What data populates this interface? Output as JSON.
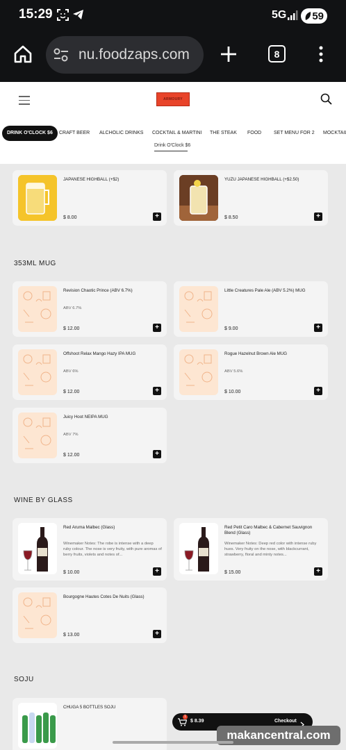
{
  "status": {
    "time": "15:29",
    "network": "5G",
    "battery": "59"
  },
  "browser": {
    "url": "nu.foodzaps.com",
    "tab_count": "8"
  },
  "site": {
    "logo_text": "ARMOURY"
  },
  "categories": [
    "DRINK O'CLOCK $6",
    "CRAFT BEER",
    "ALCHOLIC DRINKS",
    "COCKTAIL & MARTINI",
    "THE STEAK",
    "FOOD",
    "SET MENU FOR 2",
    "MOCKTAIL"
  ],
  "subcategory": "Drink O'Clock $6",
  "top_items": [
    {
      "name": "JAPANESE HIGHBALL (+$2)",
      "price": "$ 8.00"
    },
    {
      "name": "YUZU JAPANESE HIGHBALL (+$2.50)",
      "price": "$ 8.50"
    }
  ],
  "mug": {
    "title": "353ML MUG",
    "items": [
      {
        "name": "Revision Chaotic Prince (ABV 6.7%)",
        "desc": "ABV 6.7%",
        "price": "$ 12.00"
      },
      {
        "name": "Little Creatures Pale Ale (ABV 5.2%) MUG",
        "desc": "",
        "price": "$ 9.00"
      },
      {
        "name": "Offshoot Relax Mango Hazy IPA MUG",
        "desc": "ABV 6%",
        "price": "$ 12.00"
      },
      {
        "name": "Rogue Hazelnut Brown Ale MUG",
        "desc": "ABV 5.6%",
        "price": "$ 10.00"
      },
      {
        "name": "Juicy Hoot NEIPA MUG",
        "desc": "ABV 7%",
        "price": "$ 12.00"
      }
    ]
  },
  "wine": {
    "title": "WINE BY GLASS",
    "items": [
      {
        "name": "Red Aruma Malbec (Glass)",
        "desc": "Winemaker Notes: The robe is intense with a deep ruby colour. The nose is very fruity, with pure aromas of berry fruits, violets and notes of...",
        "price": "$ 10.00"
      },
      {
        "name": "Red Petit Caro Malbec & Cabernet Sauvignon Blend (Glass)",
        "desc": "Winemaker Notes: Deep red color with intense ruby hues. Very fruity on the nose, with blackcurrant, strawberry, floral and minty notes...",
        "price": "$ 15.00"
      },
      {
        "name": "Bourgogne Hautes Cotes De Nuits (Glass)",
        "desc": "",
        "price": "$ 13.00"
      }
    ]
  },
  "soju": {
    "title": "SOJU",
    "items": [
      {
        "name": "CHUGA 5 BOTTLES SOJU"
      }
    ]
  },
  "checkout": {
    "badge": "1",
    "total": "$ 8.39",
    "label": "Checkout"
  },
  "watermark": "makancentral.com",
  "colors": {
    "accent": "#e8442a",
    "dark": "#111214",
    "card": "#f4f4f4",
    "placeholder": "#fde6d2"
  }
}
